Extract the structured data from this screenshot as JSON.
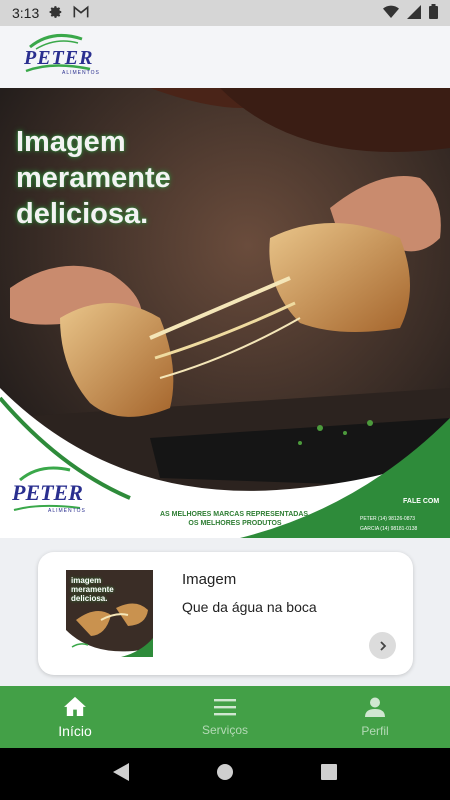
{
  "status_bar": {
    "time": "3:13",
    "icons_left": [
      "gear-icon",
      "gmail-icon"
    ],
    "icons_right": [
      "wifi-icon",
      "cellular-signal-icon",
      "battery-icon"
    ]
  },
  "header": {
    "logo_text": "PETER",
    "logo_subtext": "ALIMENTOS"
  },
  "banner": {
    "headline": [
      "Imagem",
      "meramente",
      "deliciosa."
    ],
    "logo_text": "PETER",
    "logo_subtext": "ALIMENTOS",
    "tagline": [
      "AS MELHORES MARCAS REPRESENTADAS,",
      "OS MELHORES PRODUTOS"
    ],
    "contact_title": "FALE COM",
    "contacts": [
      "PETER (14) 98126-0873",
      "GARCIA (14) 98181-0138"
    ]
  },
  "card": {
    "thumb_text": [
      "imagem",
      "meramente",
      "deliciosa."
    ],
    "title": "Imagem",
    "subtitle": "Que da água na boca",
    "arrow_icon": "chevron-right-icon"
  },
  "bottom_nav": {
    "items": [
      {
        "label": "Início",
        "icon": "home-icon",
        "active": true
      },
      {
        "label": "Serviços",
        "icon": "menu-icon",
        "active": false
      },
      {
        "label": "Perfil",
        "icon": "person-icon",
        "active": false
      }
    ]
  },
  "colors": {
    "brand_green": "#43a047",
    "brand_blue": "#2a2f8f"
  }
}
